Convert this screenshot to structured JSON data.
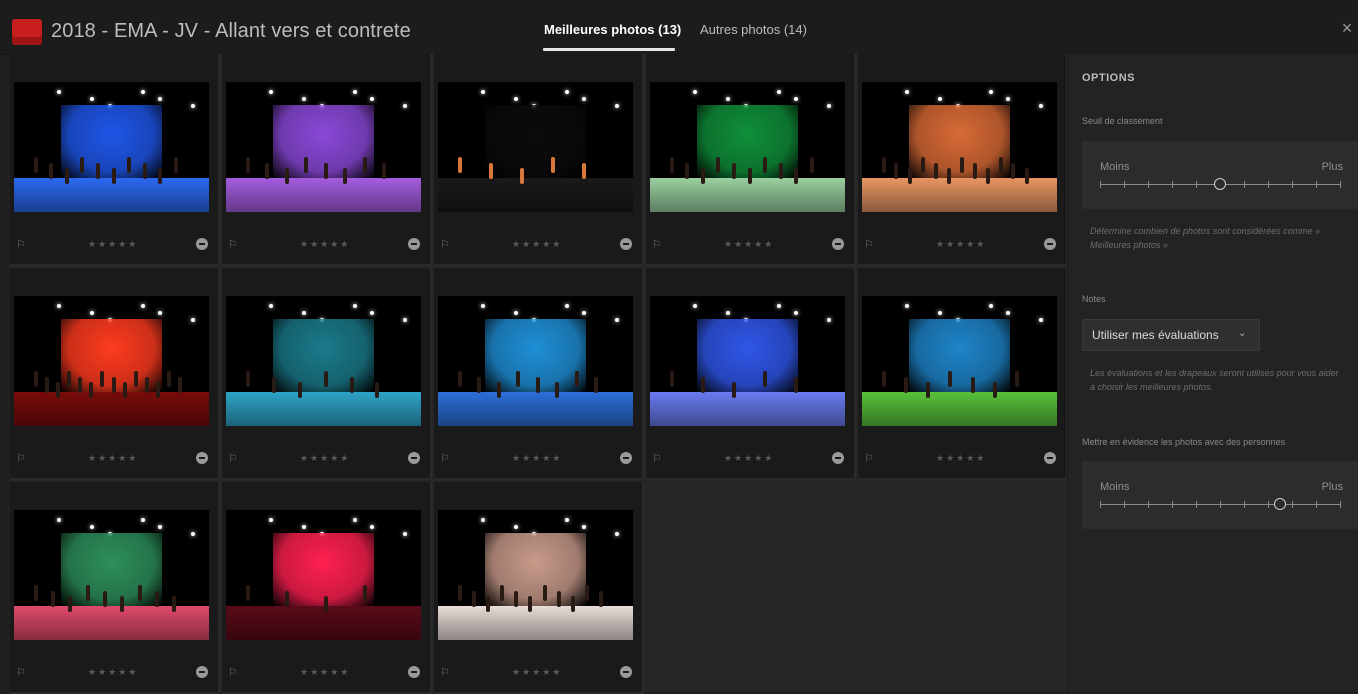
{
  "header": {
    "album_title": "2018 - EMA - JV - Allant vers et contrete",
    "tabs": [
      {
        "label": "Meilleures photos (13)",
        "active": true
      },
      {
        "label": "Autres photos (14)",
        "active": false
      }
    ],
    "close_symbol": "×"
  },
  "grid": {
    "stars_text": "★★★★★",
    "flag_symbol": "⚐",
    "photos": [
      {
        "backdrop": "#1f56e8",
        "floor": "#2b69f0",
        "tone": "blue",
        "dancers": 10
      },
      {
        "backdrop": "#8a48d8",
        "floor": "#a55de0",
        "tone": "purple",
        "dancers": 8
      },
      {
        "backdrop": "#0b0b0b",
        "floor": "#1a1a1a",
        "tone": "dark",
        "dancers": 5
      },
      {
        "backdrop": "#0f8f3a",
        "floor": "#9ad0a0",
        "tone": "green",
        "dancers": 10
      },
      {
        "backdrop": "#d86a36",
        "floor": "#e89563",
        "tone": "orange",
        "dancers": 12
      },
      {
        "backdrop": "#ff3b1f",
        "floor": "#7a0b0b",
        "tone": "red",
        "dancers": 14
      },
      {
        "backdrop": "#1a7a8a",
        "floor": "#2ea4c8",
        "tone": "teal",
        "dancers": 6
      },
      {
        "backdrop": "#1f8fd6",
        "floor": "#2c6fd8",
        "tone": "blue",
        "dancers": 8
      },
      {
        "backdrop": "#2f56e8",
        "floor": "#6a7bf0",
        "tone": "blue",
        "dancers": 5
      },
      {
        "backdrop": "#1e84c8",
        "floor": "#58c23a",
        "tone": "green",
        "dancers": 7
      },
      {
        "backdrop": "#2d8f5a",
        "floor": "#e04a6a",
        "tone": "pink",
        "dancers": 9
      },
      {
        "backdrop": "#ff2050",
        "floor": "#5a0a18",
        "tone": "red",
        "dancers": 4
      },
      {
        "backdrop": "#c89a8a",
        "floor": "#e8ddd8",
        "tone": "beige",
        "dancers": 11
      }
    ]
  },
  "options": {
    "heading": "OPTIONS",
    "threshold": {
      "label": "Seuil de classement",
      "min_label": "Moins",
      "max_label": "Plus",
      "value": 0.5,
      "hint": "Détermine combien de photos sont considérées comme « Meilleures photos »"
    },
    "notes": {
      "label": "Notes",
      "dropdown_value": "Utiliser mes évaluations",
      "chevron": "⌄",
      "hint": "Les évaluations et les drapeaux seront utilisés pour vous aider à choisir les meilleures photos."
    },
    "people": {
      "label": "Mettre en évidence les photos avec des personnes",
      "min_label": "Moins",
      "max_label": "Plus",
      "value": 0.75
    }
  }
}
